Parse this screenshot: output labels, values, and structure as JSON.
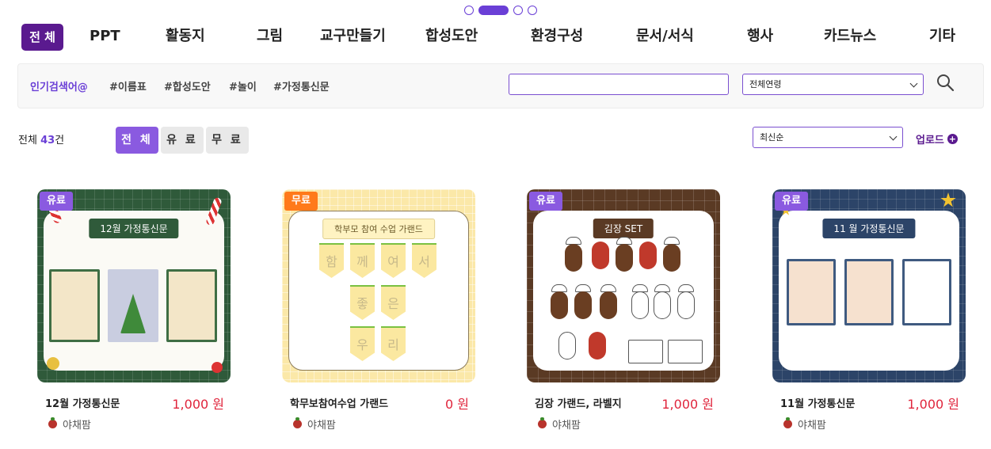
{
  "nav": {
    "items": [
      "전 체",
      "PPT",
      "활동지",
      "그림",
      "교구만들기",
      "합성도안",
      "환경구성",
      "문서/서식",
      "행사",
      "카드뉴스",
      "기타"
    ]
  },
  "search": {
    "popular_label": "인기검색어@",
    "tags": [
      "#이름표",
      "#합성도안",
      "#놀이",
      "#가정통신문"
    ],
    "input_value": "",
    "age_select": "전체연령"
  },
  "filters": {
    "total_prefix": "전체",
    "total_count": "43",
    "total_suffix": "건",
    "buttons": [
      "전 체",
      "유 료",
      "무 료"
    ],
    "sort": "최신순",
    "upload": "업로드"
  },
  "cards": [
    {
      "badge": "유료",
      "thumb_title": "12월 가정통신문",
      "title": "12월 가정통신문",
      "price": "1,000 원",
      "author": "야채팜"
    },
    {
      "badge": "무료",
      "thumb_title": "학부모 참여 수업 가랜드",
      "pennants": [
        "함",
        "께",
        "여",
        "서",
        "좋",
        "은",
        "우",
        "리"
      ],
      "title": "학무보참여수업 가랜드",
      "price": "0 원",
      "author": "야채팜"
    },
    {
      "badge": "유료",
      "thumb_title": "김장 SET",
      "title": "김장 가랜드, 라벨지",
      "price": "1,000 원",
      "author": "야채팜"
    },
    {
      "badge": "유료",
      "thumb_title": "11 월 가정통신문",
      "title": "11월 가정통신문",
      "price": "1,000 원",
      "author": "야채팜"
    }
  ],
  "colors": {
    "accent": "#6a3fd6",
    "nav_active": "#5a1a8f",
    "price": "#e0253c",
    "free_badge": "#ff7a1a"
  }
}
